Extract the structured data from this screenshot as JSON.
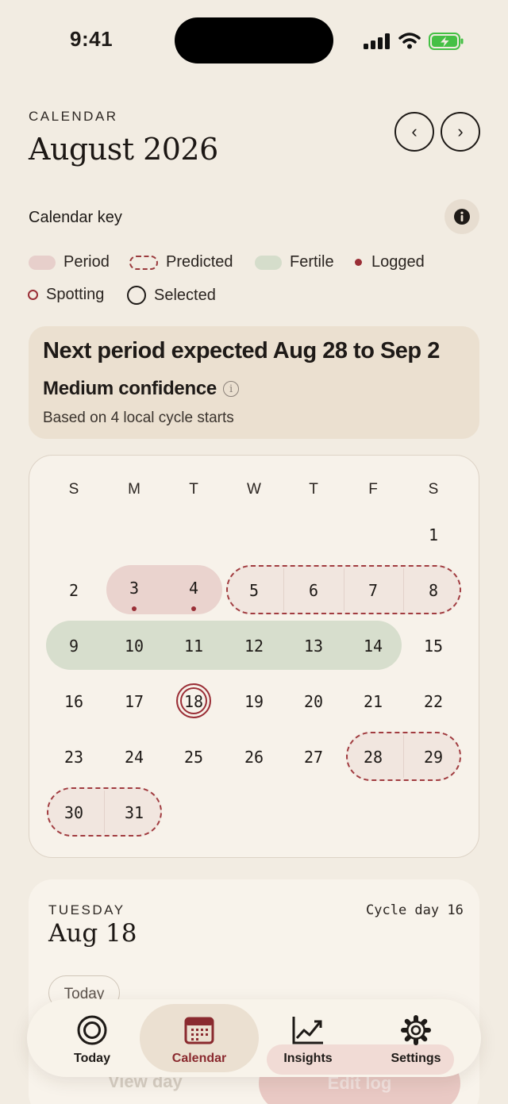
{
  "status": {
    "time": "9:41"
  },
  "header": {
    "eyebrow": "CALENDAR",
    "title": "August 2026",
    "prev": "‹",
    "next": "›"
  },
  "key": {
    "title": "Calendar key",
    "items": [
      "Period",
      "Predicted",
      "Fertile",
      "Logged",
      "Spotting",
      "Selected"
    ]
  },
  "prediction": {
    "title": "Next period expected Aug 28 to Sep 2",
    "confidence": "Medium confidence",
    "basis": "Based on 4 local cycle starts"
  },
  "calendar": {
    "weekdays": [
      "S",
      "M",
      "T",
      "W",
      "T",
      "F",
      "S"
    ],
    "days": [
      "1",
      "2",
      "3",
      "4",
      "5",
      "6",
      "7",
      "8",
      "9",
      "10",
      "11",
      "12",
      "13",
      "14",
      "15",
      "16",
      "17",
      "18",
      "19",
      "20",
      "21",
      "22",
      "23",
      "24",
      "25",
      "26",
      "27",
      "28",
      "29",
      "30",
      "31"
    ],
    "period_days": [
      3,
      4
    ],
    "predicted_days": [
      5,
      6,
      7,
      8,
      28,
      29,
      30,
      31
    ],
    "fertile_days": [
      9,
      10,
      11,
      12,
      13,
      14
    ],
    "logged_days": [
      3,
      4
    ],
    "selected_day": 18
  },
  "day_detail": {
    "weekday": "TUESDAY",
    "date": "Aug 18",
    "cycle_day": "Cycle day 16",
    "today_chip": "Today"
  },
  "actions": {
    "view_day": "View day",
    "edit_log": "Edit log"
  },
  "tabs": [
    {
      "label": "Today",
      "icon": "target-icon",
      "active": false
    },
    {
      "label": "Calendar",
      "icon": "calendar-icon",
      "active": true
    },
    {
      "label": "Insights",
      "icon": "chart-icon",
      "active": false
    },
    {
      "label": "Settings",
      "icon": "gear-icon",
      "active": false
    }
  ],
  "colors": {
    "accent": "#9a2e36",
    "period": "#ead3ce",
    "fertile": "#d7decd",
    "background": "#f2ece2"
  }
}
